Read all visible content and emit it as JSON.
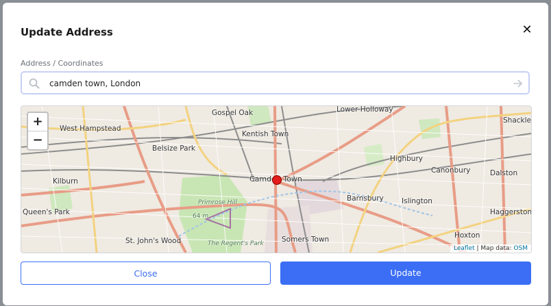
{
  "dialog": {
    "title": "Update Address",
    "close_symbol": "✕"
  },
  "search": {
    "label": "Address / Coordinates",
    "value": "camden town, London",
    "icon": "search-icon",
    "go_icon": "arrow-right-icon"
  },
  "map": {
    "zoom_in": "+",
    "zoom_out": "−",
    "attribution_prefix": "Leaflet",
    "attribution_sep": " | Map data: ",
    "attribution_source": "OSM",
    "marker_color": "#e21b1b",
    "labels": {
      "gospel_oak": "Gospel Oak",
      "lower_holloway": "Lower Holloway",
      "west_hampstead": "West Hampstead",
      "kentish_town": "Kentish Town",
      "shackle": "Shackle",
      "belsize_park": "Belsize Park",
      "highbury": "Highbury",
      "canonbury": "Canonbury",
      "dalston": "Dalston",
      "kilburn": "Kilburn",
      "camden_town": "Camden Town",
      "primrose_hill": "Primrose Hill",
      "barnsbury": "Barnsbury",
      "islington": "Islington",
      "queens_park": "Queen's Park",
      "haggerston": "Haggerston",
      "st_johns_wood": "St. John's Wood",
      "somers_town": "Somers Town",
      "hoxton": "Hoxton",
      "regents_park": "The Regent's Park",
      "height": "64 m"
    }
  },
  "buttons": {
    "close": "Close",
    "update": "Update"
  },
  "colors": {
    "primary": "#3b6ef5",
    "input_border": "#c6d0f5"
  }
}
